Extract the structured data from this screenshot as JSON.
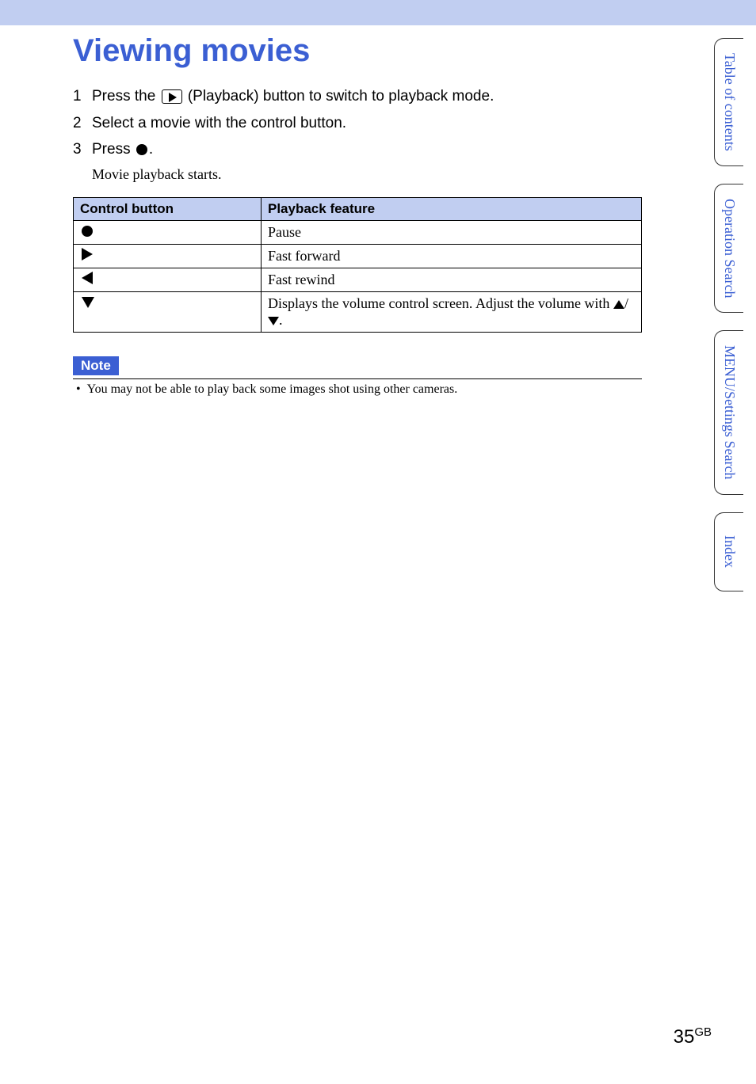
{
  "title": "Viewing movies",
  "steps": [
    {
      "num": "1",
      "pre": "Press the ",
      "post": " (Playback) button to switch to playback mode.",
      "icon": "playback"
    },
    {
      "num": "2",
      "pre": "Select a movie with the control button.",
      "post": "",
      "icon": null
    },
    {
      "num": "3",
      "pre": "Press ",
      "post": ".",
      "icon": "dot"
    }
  ],
  "sub_text": "Movie playback starts.",
  "table": {
    "headers": [
      "Control button",
      "Playback feature"
    ],
    "rows": [
      {
        "icon": "dot",
        "feature": "Pause"
      },
      {
        "icon": "right",
        "feature": "Fast forward"
      },
      {
        "icon": "left",
        "feature": "Fast rewind"
      },
      {
        "icon": "down",
        "feature_pre": "Displays the volume control screen. Adjust the volume with ",
        "feature_post": "."
      }
    ]
  },
  "note": {
    "label": "Note",
    "text": "You may not be able to play back some images shot using other cameras."
  },
  "tabs": [
    "Table of\ncontents",
    "Operation\nSearch",
    "MENU/Settings\nSearch",
    "Index"
  ],
  "footer": {
    "page": "35",
    "region": "GB"
  }
}
